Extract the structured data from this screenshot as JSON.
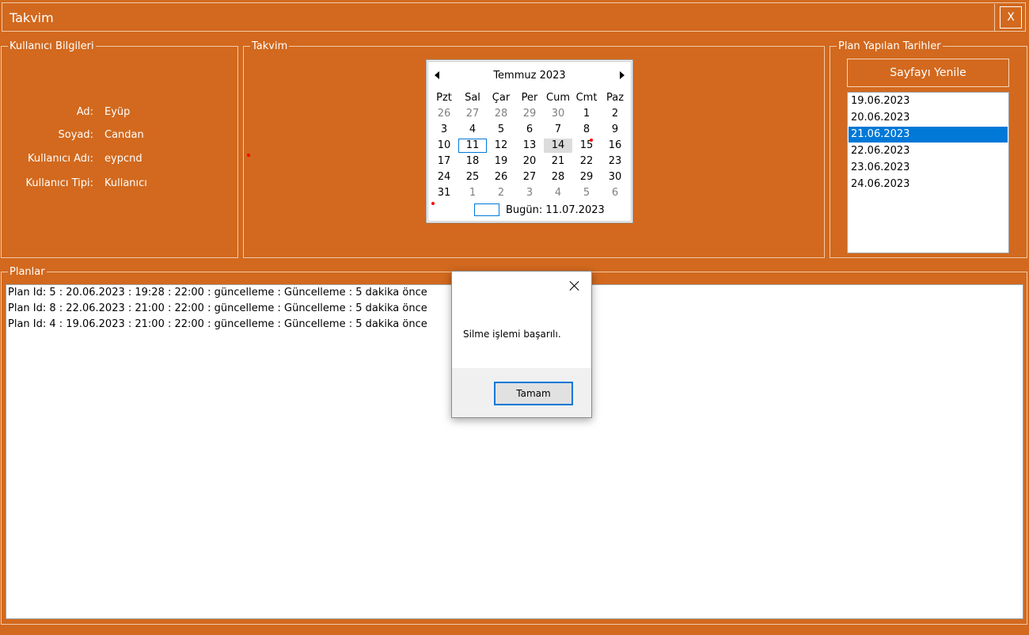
{
  "window": {
    "title": "Takvim",
    "close_label": "X"
  },
  "user_info": {
    "legend": "Kullanıcı Bilgileri",
    "rows": [
      {
        "label": "Ad:",
        "value": "Eyüp"
      },
      {
        "label": "Soyad:",
        "value": "Candan"
      },
      {
        "label": "Kullanıcı Adı:",
        "value": "eypcnd"
      },
      {
        "label": "Kullanıcı Tipi:",
        "value": "Kullanıcı"
      }
    ]
  },
  "calendar": {
    "legend": "Takvim",
    "month_label": "Temmuz 2023",
    "weekdays": [
      "Pzt",
      "Sal",
      "Çar",
      "Per",
      "Cum",
      "Cmt",
      "Paz"
    ],
    "weeks": [
      [
        "26",
        "27",
        "28",
        "29",
        "30",
        "1",
        "2"
      ],
      [
        "3",
        "4",
        "5",
        "6",
        "7",
        "8",
        "9"
      ],
      [
        "10",
        "11",
        "12",
        "13",
        "14",
        "15",
        "16"
      ],
      [
        "17",
        "18",
        "19",
        "20",
        "21",
        "22",
        "23"
      ],
      [
        "24",
        "25",
        "26",
        "27",
        "28",
        "29",
        "30"
      ],
      [
        "31",
        "1",
        "2",
        "3",
        "4",
        "5",
        "6"
      ]
    ],
    "today_text": "Bugün: 11.07.2023",
    "today_day": "11",
    "selected_day": "14"
  },
  "planned_dates": {
    "legend": "Plan Yapılan Tarihler",
    "refresh_label": "Sayfayı Yenile",
    "items": [
      "19.06.2023",
      "20.06.2023",
      "21.06.2023",
      "22.06.2023",
      "23.06.2023",
      "24.06.2023"
    ],
    "selected_index": 2
  },
  "plans": {
    "legend": "Planlar",
    "items": [
      "Plan Id: 5 : 20.06.2023 : 19:28 : 22:00 : güncelleme : Güncelleme : 5 dakika önce",
      "Plan Id: 8 : 22.06.2023 : 21:00 : 22:00 : güncelleme : Güncelleme : 5 dakika önce",
      "Plan Id: 4 : 19.06.2023 : 21:00 : 22:00 : güncelleme : Güncelleme : 5 dakika önce"
    ]
  },
  "dialog": {
    "message": "Silme işlemi başarılı.",
    "ok_label": "Tamam"
  },
  "colors": {
    "background": "#d2691e",
    "selection": "#0078d7"
  }
}
